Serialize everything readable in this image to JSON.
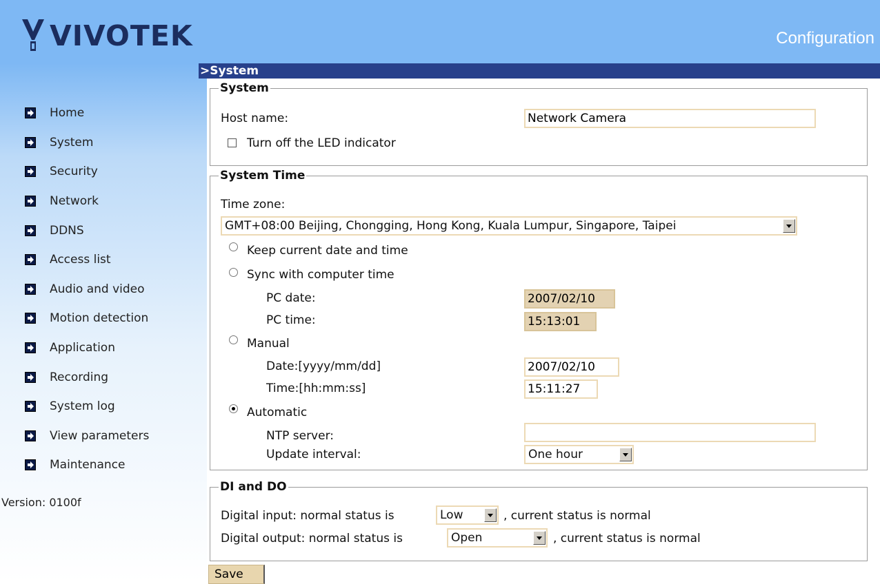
{
  "header": {
    "logo_text": "VIVOTEK",
    "page_title": "Configuration"
  },
  "sidebar": {
    "items": [
      {
        "label": "Home"
      },
      {
        "label": "System"
      },
      {
        "label": "Security"
      },
      {
        "label": "Network"
      },
      {
        "label": "DDNS"
      },
      {
        "label": "Access list"
      },
      {
        "label": "Audio and video"
      },
      {
        "label": "Motion detection"
      },
      {
        "label": "Application"
      },
      {
        "label": "Recording"
      },
      {
        "label": "System log"
      },
      {
        "label": "View parameters"
      },
      {
        "label": "Maintenance"
      }
    ],
    "version": "Version: 0100f"
  },
  "main": {
    "section_title": ">System",
    "system": {
      "legend": "System",
      "host_name_label": "Host name:",
      "host_name_value": "Network Camera",
      "led_label": "Turn off the LED indicator",
      "led_checked": false
    },
    "system_time": {
      "legend": "System Time",
      "time_zone_label": "Time zone:",
      "time_zone_value": "GMT+08:00 Beijing, Chongging, Hong Kong, Kuala Lumpur, Singapore, Taipei",
      "keep_label": "Keep current date and time",
      "sync_label": "Sync with computer time",
      "pc_date_label": "PC date:",
      "pc_date_value": "2007/02/10",
      "pc_time_label": "PC time:",
      "pc_time_value": "15:13:01",
      "manual_label": "Manual",
      "date_label": "Date:[yyyy/mm/dd]",
      "date_value": "2007/02/10",
      "time_label": "Time:[hh:mm:ss]",
      "time_value": "15:11:27",
      "automatic_label": "Automatic",
      "selected_mode": "Automatic",
      "ntp_label": "NTP server:",
      "ntp_value": "",
      "interval_label": "Update interval:",
      "interval_value": "One hour"
    },
    "di_do": {
      "legend": "DI and DO",
      "di_prefix": "Digital input: normal status is",
      "di_value": "Low",
      "di_suffix": ", current status is normal",
      "do_prefix": "Digital output: normal status is",
      "do_value": "Open",
      "do_suffix": ", current status is normal"
    },
    "save_label": "Save"
  }
}
